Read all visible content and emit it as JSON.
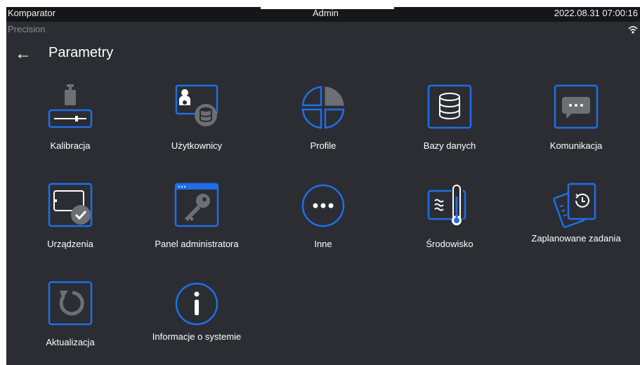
{
  "status_bar": {
    "app_name": "Komparator",
    "user": "Admin",
    "datetime": "2022.08.31 07:00:16",
    "mode": "Precision"
  },
  "header": {
    "back_icon": "arrow-left-icon",
    "title": "Parametry"
  },
  "tiles": [
    {
      "label": "Kalibracja",
      "icon": "calibration-icon"
    },
    {
      "label": "Użytkownicy",
      "icon": "users-icon"
    },
    {
      "label": "Profile",
      "icon": "profiles-icon"
    },
    {
      "label": "Bazy danych",
      "icon": "database-icon"
    },
    {
      "label": "Komunikacja",
      "icon": "chat-icon"
    },
    {
      "label": "Urządzenia",
      "icon": "devices-icon"
    },
    {
      "label": "Panel administratora",
      "icon": "admin-key-icon"
    },
    {
      "label": "Inne",
      "icon": "more-icon"
    },
    {
      "label": "Środowisko",
      "icon": "environment-icon"
    },
    {
      "label": "Zaplanowane zadania",
      "icon": "scheduled-tasks-icon"
    },
    {
      "label": "Aktualizacja",
      "icon": "update-icon"
    },
    {
      "label": "Informacje o systemie",
      "icon": "info-icon"
    }
  ],
  "colors": {
    "accent": "#1f6fe6",
    "background": "#2b2d33",
    "topbar": "#15161a",
    "icon_gray": "#6e6f75"
  }
}
